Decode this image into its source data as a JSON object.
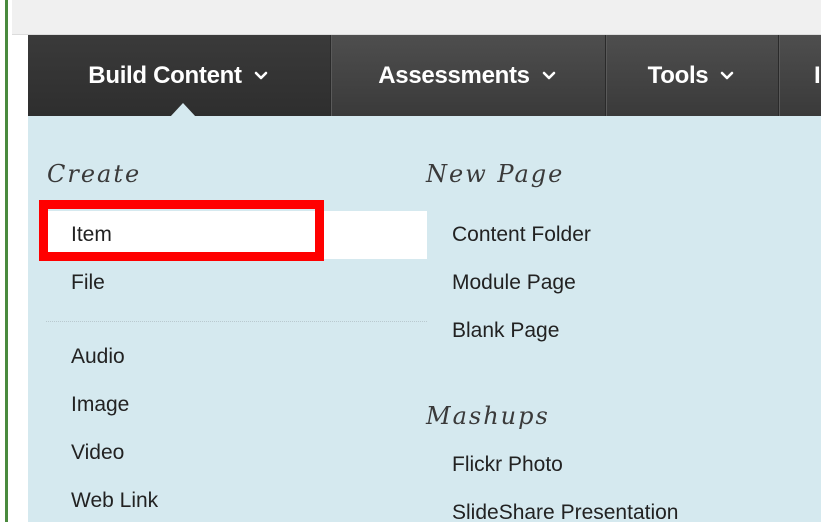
{
  "tabs": [
    {
      "label": "Build Content",
      "active": true
    },
    {
      "label": "Assessments",
      "active": false
    },
    {
      "label": "Tools",
      "active": false
    },
    {
      "label": "I",
      "active": false
    }
  ],
  "menu": {
    "create": {
      "heading": "Create",
      "items": [
        "Item",
        "File",
        "Audio",
        "Image",
        "Video",
        "Web Link"
      ],
      "selected": "Item"
    },
    "new_page": {
      "heading": "New Page",
      "items": [
        "Content Folder",
        "Module Page",
        "Blank Page"
      ]
    },
    "mashups": {
      "heading": "Mashups",
      "items": [
        "Flickr Photo",
        "SlideShare Presentation"
      ]
    }
  },
  "colors": {
    "tab_bar": "#454545",
    "menu_bg": "#d5e9ef",
    "highlight": "#ff0000",
    "frame_green": "#4a8a3e"
  },
  "icons": {
    "tab_chevron": "chevron-down-icon"
  }
}
